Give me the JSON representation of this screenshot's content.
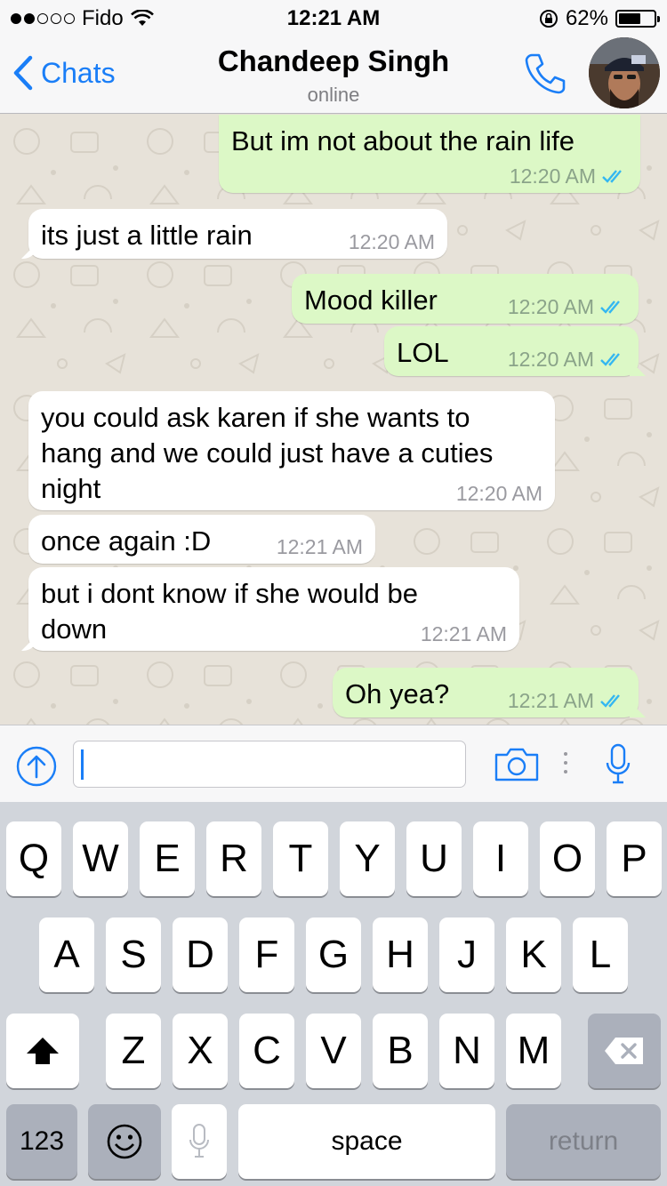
{
  "status": {
    "carrier": "Fido",
    "time": "12:21 AM",
    "battery": "62%",
    "battery_level": 0.62
  },
  "nav": {
    "back_label": "Chats",
    "name": "Chandeep Singh",
    "status": "online"
  },
  "messages": [
    {
      "dir": "out",
      "text": "But im not about the rain life",
      "time": "12:20 AM",
      "read": true
    },
    {
      "dir": "in",
      "text": "its just a little rain",
      "time": "12:20 AM"
    },
    {
      "dir": "out",
      "text": "Mood killer",
      "time": "12:20 AM",
      "read": true
    },
    {
      "dir": "out",
      "text": "LOL",
      "time": "12:20 AM",
      "read": true
    },
    {
      "dir": "in",
      "text": "you could ask karen if she wants to hang and we could just have a cuties night",
      "time": "12:20 AM"
    },
    {
      "dir": "in",
      "text": "once again :D",
      "time": "12:21 AM"
    },
    {
      "dir": "in",
      "text": "but i dont know if she would be down",
      "time": "12:21 AM"
    },
    {
      "dir": "out",
      "text": "Oh yea?",
      "time": "12:21 AM",
      "read": true
    }
  ],
  "input": {
    "value": ""
  },
  "keyboard": {
    "row1": [
      "Q",
      "W",
      "E",
      "R",
      "T",
      "Y",
      "U",
      "I",
      "O",
      "P"
    ],
    "row2": [
      "A",
      "S",
      "D",
      "F",
      "G",
      "H",
      "J",
      "K",
      "L"
    ],
    "row3": [
      "Z",
      "X",
      "C",
      "V",
      "B",
      "N",
      "M"
    ],
    "numbers_label": "123",
    "space_label": "space",
    "return_label": "return"
  },
  "colors": {
    "accent": "#1a7ef7",
    "outgoing": "#dcf8c6",
    "incoming": "#ffffff",
    "chat_bg": "#e7e2d9",
    "read_tick": "#34b7f1"
  },
  "icons": [
    "wifi-icon",
    "lock-rotation-icon",
    "battery-icon",
    "back-chevron-icon",
    "phone-icon",
    "avatar",
    "share-icon",
    "camera-icon",
    "microphone-icon",
    "shift-icon",
    "delete-icon",
    "emoji-icon",
    "dictation-icon"
  ]
}
